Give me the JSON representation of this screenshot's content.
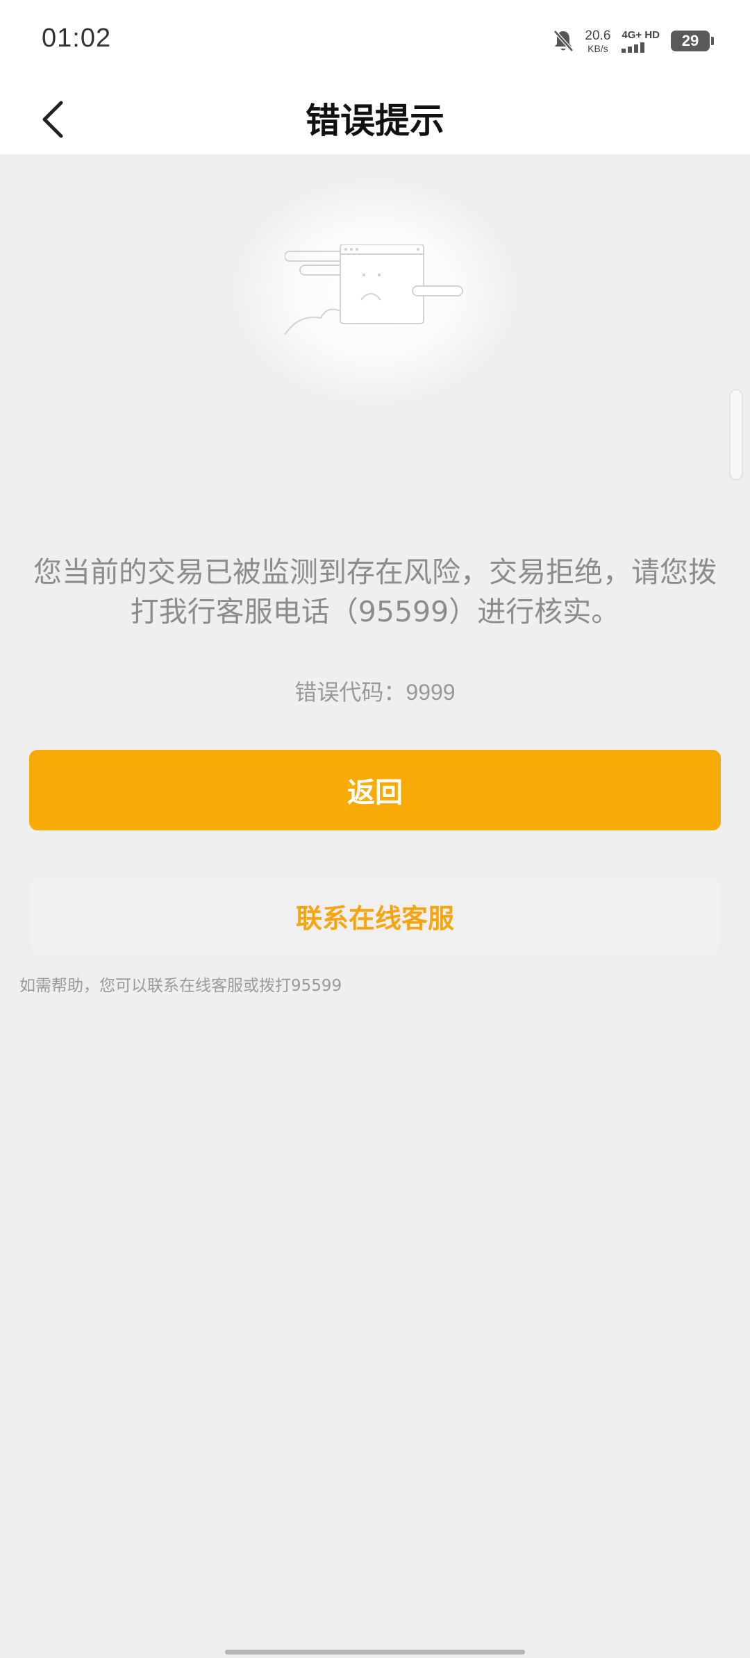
{
  "status_bar": {
    "time": "01:02",
    "net_speed_value": "20.6",
    "net_speed_unit": "KB/s",
    "network_type": "4G+ HD",
    "battery_level": "29",
    "icons": [
      "bell-off-icon",
      "signal-icon",
      "battery-icon"
    ]
  },
  "nav": {
    "title": "错误提示",
    "back_icon": "chevron-left-icon"
  },
  "illustration": {
    "icon": "sad-browser-window-icon"
  },
  "message": {
    "text": "您当前的交易已被监测到存在风险，交易拒绝，请您拨打我行客服电话（95599）进行核实。",
    "error_code_label": "错误代码：",
    "error_code_value": "9999"
  },
  "buttons": {
    "return_label": "返回",
    "contact_label": "联系在线客服"
  },
  "help_text": "如需帮助，您可以联系在线客服或拨打95599",
  "colors": {
    "accent": "#f8aa07",
    "contact_text": "#f5a512",
    "background": "#efefef"
  }
}
